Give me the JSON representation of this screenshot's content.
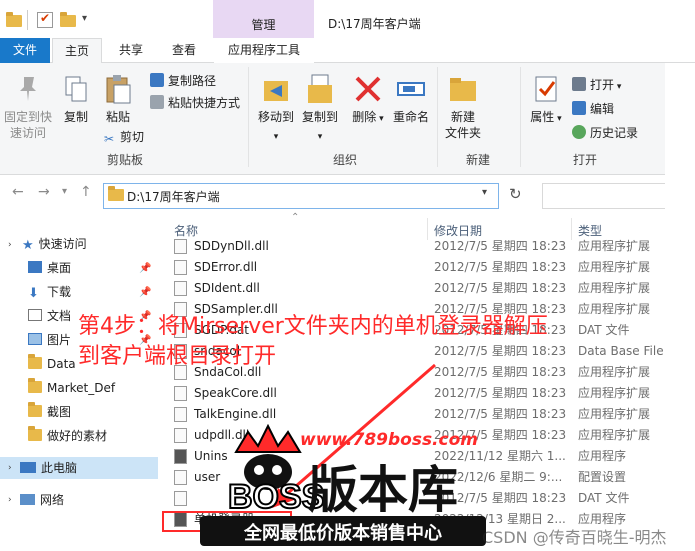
{
  "window": {
    "title": "D:\\17周年客户端",
    "context_group": "管理"
  },
  "tabs": [
    {
      "label": "文件"
    },
    {
      "label": "主页"
    },
    {
      "label": "共享"
    },
    {
      "label": "查看"
    },
    {
      "label": "应用程序工具"
    }
  ],
  "ribbon": {
    "clipboard": {
      "label": "剪贴板",
      "pin": "固定到快\n速访问",
      "copy": "复制",
      "paste": "粘贴",
      "copy_path": "复制路径",
      "paste_shortcut": "粘贴快捷方式",
      "cut": "剪切"
    },
    "organize": {
      "label": "组织",
      "move_to": "移动到",
      "copy_to": "复制到",
      "delete": "删除",
      "rename": "重命名"
    },
    "new": {
      "label": "新建",
      "new_folder": "新建\n文件夹"
    },
    "open": {
      "label": "打开",
      "properties": "属性",
      "open": "打开",
      "edit": "编辑",
      "history": "历史记录"
    }
  },
  "address": {
    "path": "D:\\17周年客户端"
  },
  "nav_pane": {
    "quick_access": "快速访问",
    "items": [
      {
        "label": "桌面",
        "pinned": true
      },
      {
        "label": "下载",
        "pinned": true
      },
      {
        "label": "文档",
        "pinned": true
      },
      {
        "label": "图片",
        "pinned": true
      },
      {
        "label": "Data"
      },
      {
        "label": "Market_Def"
      },
      {
        "label": "截图"
      },
      {
        "label": "做好的素材"
      }
    ],
    "this_pc": "此电脑",
    "network": "网络"
  },
  "file_list": {
    "columns": [
      "名称",
      "修改日期",
      "类型"
    ],
    "rows": [
      {
        "name": "SDDynDll.dll",
        "date": "2012/7/5 星期四 18:23",
        "type": "应用程序扩展"
      },
      {
        "name": "SDError.dll",
        "date": "2012/7/5 星期四 18:23",
        "type": "应用程序扩展"
      },
      {
        "name": "SDIdent.dll",
        "date": "2012/7/5 星期四 18:23",
        "type": "应用程序扩展"
      },
      {
        "name": "SDSampler.dll",
        "date": "2012/7/5 星期四 18:23",
        "type": "应用程序扩展"
      },
      {
        "name": "SGDP.dat",
        "date": "2012/7/5 星期四 18:23",
        "type": "DAT 文件"
      },
      {
        "name": "sndacol",
        "date": "2012/7/5 星期四 18:23",
        "type": "Data Base File"
      },
      {
        "name": "SndaCol.dll",
        "date": "2012/7/5 星期四 18:23",
        "type": "应用程序扩展"
      },
      {
        "name": "SpeakCore.dll",
        "date": "2012/7/5 星期四 18:23",
        "type": "应用程序扩展"
      },
      {
        "name": "TalkEngine.dll",
        "date": "2012/7/5 星期四 18:23",
        "type": "应用程序扩展"
      },
      {
        "name": "udpdll.dll",
        "date": "2012/7/5 星期四 18:23",
        "type": "应用程序扩展"
      },
      {
        "name": "Unins",
        "date": "2022/11/12 星期六 1...",
        "type": "应用程序"
      },
      {
        "name": "user",
        "date": "2022/12/6 星期二 9:...",
        "type": "配置设置"
      },
      {
        "name": "",
        "date": "2012/7/5 星期四 18:23",
        "type": "DAT 文件"
      },
      {
        "name": "单机登录器",
        "date": "2022/12/13 星期日 2...",
        "type": "应用程序"
      }
    ]
  },
  "overlay": {
    "step_instruction": "第4步：将Mirserver文件夹内的单机登录器解压到客户端根目录打开",
    "logo_url": "www.789boss.com",
    "logo_boss": "BOSS",
    "logo_cn": "版本库",
    "logo_slogan": "全网最低价版本销售中心",
    "watermark": "CSDN @传奇百晓生-明杰"
  },
  "colors": {
    "accent": "#1979ca",
    "context_tab": "#e8d8f3",
    "overlay_red": "#ff2a2a"
  }
}
